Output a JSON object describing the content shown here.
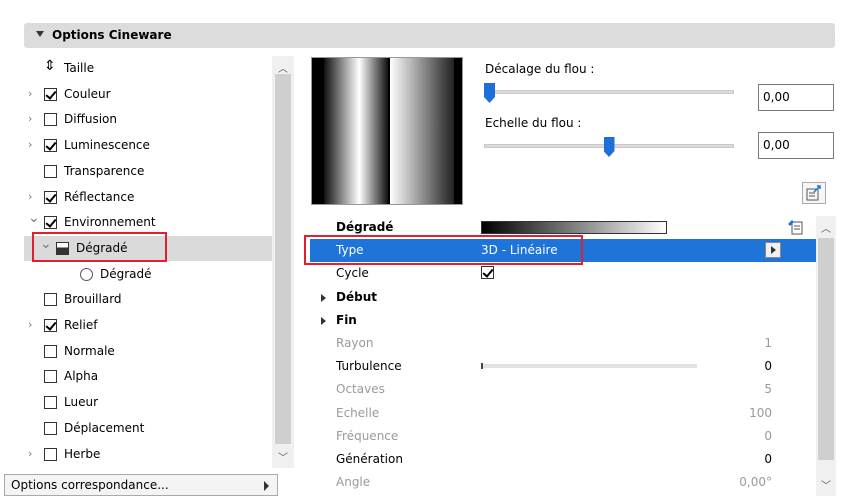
{
  "header": {
    "title": "Options Cineware"
  },
  "tree": {
    "items": [
      {
        "label": "Taille",
        "has_expander": false,
        "checkbox": "none",
        "icon": "resize-icon",
        "indent": 0
      },
      {
        "label": "Couleur",
        "has_expander": true,
        "checkbox": "checked",
        "indent": 0
      },
      {
        "label": "Diffusion",
        "has_expander": true,
        "checkbox": "unchecked",
        "indent": 0
      },
      {
        "label": "Luminescence",
        "has_expander": true,
        "checkbox": "checked",
        "indent": 0
      },
      {
        "label": "Transparence",
        "has_expander": false,
        "checkbox": "unchecked",
        "indent": 0
      },
      {
        "label": "Réflectance",
        "has_expander": true,
        "checkbox": "checked",
        "indent": 0
      },
      {
        "label": "Environnement",
        "has_expander": true,
        "expanded": true,
        "checkbox": "checked",
        "indent": 0
      },
      {
        "label": "Dégradé",
        "has_expander": true,
        "expanded": true,
        "checkbox": "gradient",
        "indent": 1,
        "selected": true
      },
      {
        "label": "Dégradé",
        "has_expander": false,
        "checkbox": "radio",
        "indent": 2
      },
      {
        "label": "Brouillard",
        "has_expander": false,
        "checkbox": "unchecked",
        "indent": 0
      },
      {
        "label": "Relief",
        "has_expander": true,
        "checkbox": "checked",
        "indent": 0
      },
      {
        "label": "Normale",
        "has_expander": false,
        "checkbox": "unchecked",
        "indent": 0
      },
      {
        "label": "Alpha",
        "has_expander": false,
        "checkbox": "unchecked",
        "indent": 0
      },
      {
        "label": "Lueur",
        "has_expander": false,
        "checkbox": "unchecked",
        "indent": 0
      },
      {
        "label": "Déplacement",
        "has_expander": false,
        "checkbox": "unchecked",
        "indent": 0
      },
      {
        "label": "Herbe",
        "has_expander": true,
        "checkbox": "unchecked",
        "indent": 0
      }
    ]
  },
  "options_correspondance": {
    "label": "Options correspondance..."
  },
  "blur": {
    "offset_label": "Décalage du flou :",
    "offset_value": "0,00",
    "offset_slider_fraction": 0.0,
    "scale_label": "Echelle du flou :",
    "scale_value": "0,00",
    "scale_slider_fraction": 0.5
  },
  "properties": [
    {
      "key": "Dégradé",
      "style": "bold",
      "control": "gradient"
    },
    {
      "key": "Type",
      "value": "3D - Linéaire",
      "style": "selected",
      "control": "dropdown"
    },
    {
      "key": "Cycle",
      "style": "normal",
      "control": "checkbox",
      "checked": true
    },
    {
      "key": "Début",
      "style": "bold",
      "control": "group"
    },
    {
      "key": "Fin",
      "style": "bold",
      "control": "group"
    },
    {
      "key": "Rayon",
      "right": "1",
      "style": "disabled"
    },
    {
      "key": "Turbulence",
      "right": "0",
      "style": "normal",
      "control": "slider",
      "slider_fraction": 0.0
    },
    {
      "key": "Octaves",
      "right": "5",
      "style": "disabled"
    },
    {
      "key": "Echelle",
      "right": "100",
      "style": "disabled"
    },
    {
      "key": "Fréquence",
      "right": "0",
      "style": "disabled"
    },
    {
      "key": "Génération",
      "right": "0",
      "style": "normal"
    },
    {
      "key": "Angle",
      "right": "0,00°",
      "style": "disabled"
    }
  ],
  "colors": {
    "selection": "#1e74d8",
    "highlight_box": "#e0202a",
    "slider_thumb": "#1e6fd9"
  }
}
